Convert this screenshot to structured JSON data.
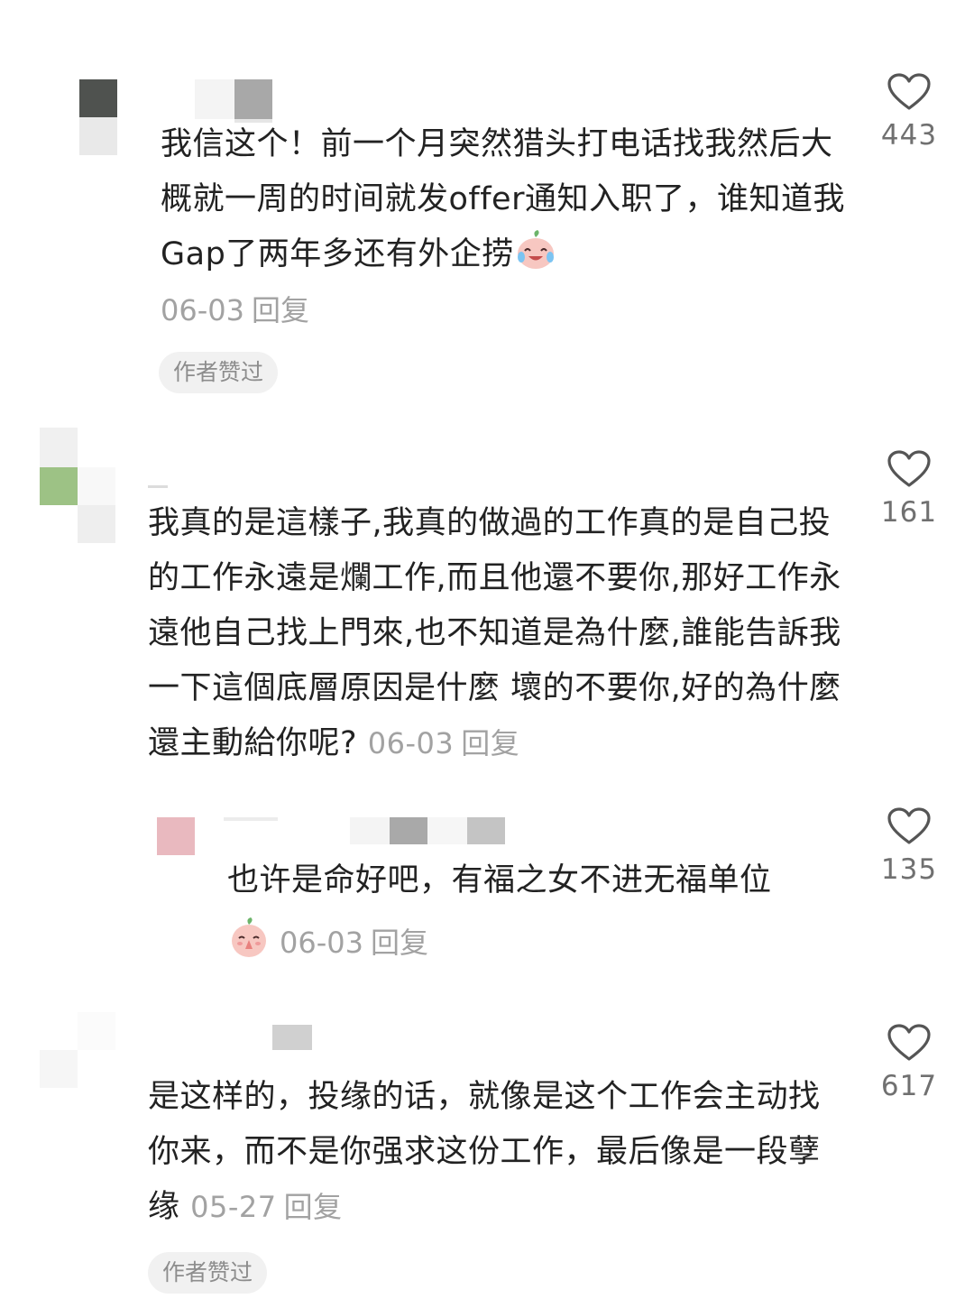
{
  "comments": [
    {
      "text": "我信这个！前一个月突然猎头打电话找我然后大概就一周的时间就发offer通知入职了，谁知道我Gap了两年多还有外企捞",
      "emoji": "crying-laughing-peach-emoji",
      "date": "06-03",
      "reply_label": "回复",
      "author_liked_label": "作者赞过",
      "likes": "443"
    },
    {
      "text": "我真的是這樣子,我真的做過的工作真的是自己投的工作永遠是爛工作,而且他還不要你,那好工作永遠他自己找上門來,也不知道是為什麼,誰能告訴我一下這個底層原因是什麼 壞的不要你,好的為什麼還主動給你呢?",
      "date": "06-03",
      "reply_label": "回复",
      "likes": "161",
      "replies": [
        {
          "text": "也许是命好吧，有福之女不进无福单位",
          "emoji": "praying-peach-emoji",
          "date": "06-03",
          "reply_label": "回复",
          "likes": "135"
        }
      ]
    },
    {
      "text": "是这样的，投缘的话，就像是这个工作会主动找你来，而不是你强求这份工作，最后像是一段孽缘",
      "date": "05-27",
      "reply_label": "回复",
      "author_liked_label": "作者赞过",
      "likes": "617"
    }
  ],
  "colors": {
    "text": "#222222",
    "meta": "#a2a2a2",
    "pill_bg": "#f1f1f1",
    "heart": "#555555",
    "avatar_pink": "#e9b9bf",
    "avatar_green": "#9dc285",
    "avatar_dark": "#4f524f"
  }
}
